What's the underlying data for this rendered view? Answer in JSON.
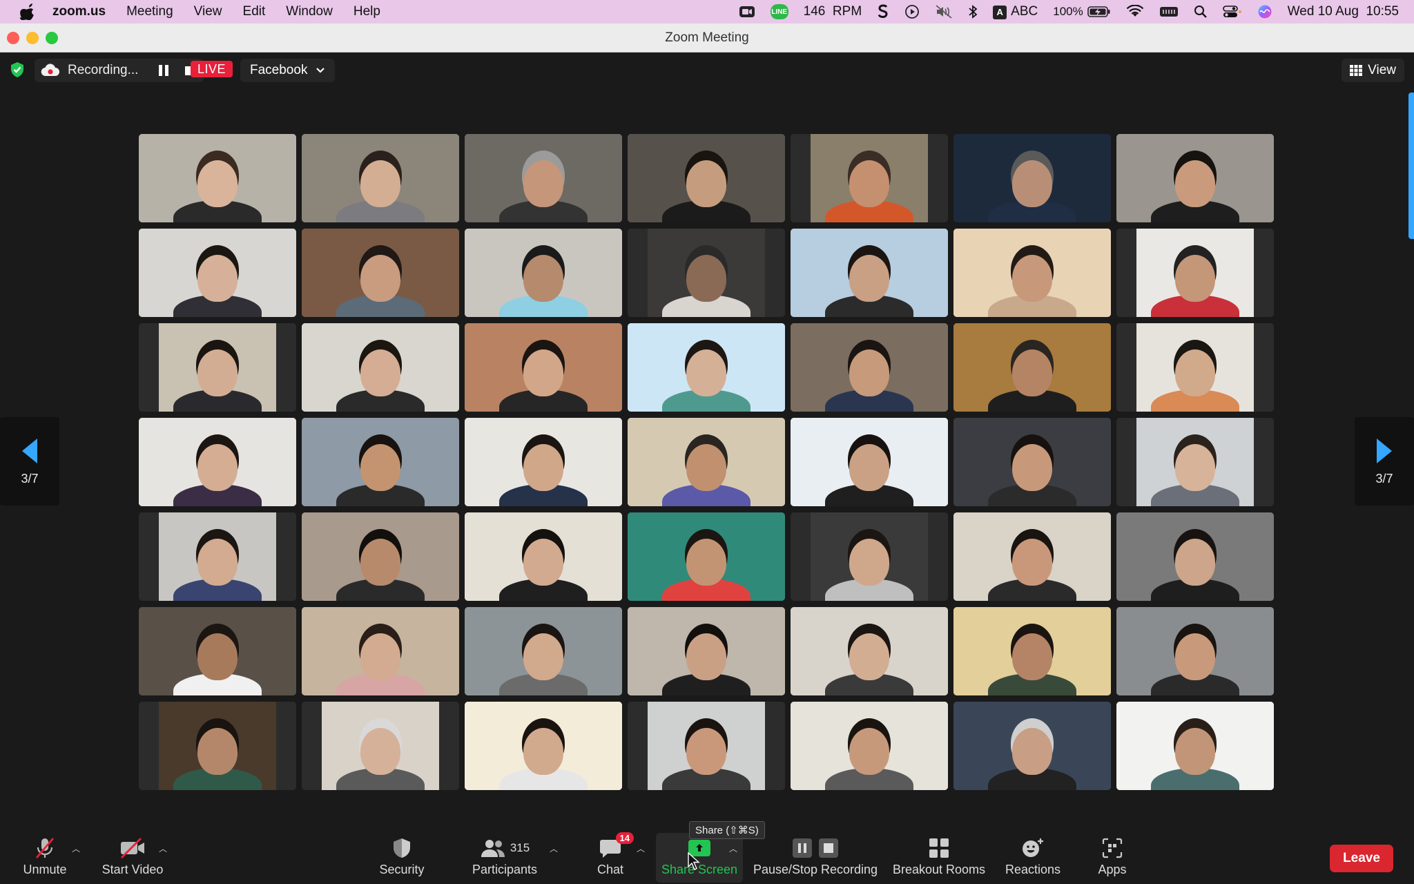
{
  "menubar": {
    "app_name": "zoom.us",
    "items": [
      "Meeting",
      "View",
      "Edit",
      "Window",
      "Help"
    ],
    "rpm_value": "146",
    "rpm_unit": "RPM",
    "input_source": "ABC",
    "input_letter": "A",
    "battery_percent": "100%",
    "datetime": "Wed 10 Aug  10:55",
    "line_label": "LINE"
  },
  "window": {
    "title": "Zoom Meeting"
  },
  "topstrip": {
    "recording_label": "Recording...",
    "live_label": "LIVE",
    "stream_target": "Facebook",
    "view_label": "View"
  },
  "gallery": {
    "page_indicator": "3/7",
    "tiles": [
      {
        "bg": "#b7b2a8",
        "skin": "#d9b49a",
        "shirt": "#2a2a2a",
        "hair": "#3a2a20",
        "narrow": false
      },
      {
        "bg": "#8c857a",
        "skin": "#d3ae92",
        "shirt": "#7b7b80",
        "hair": "#2b211c",
        "narrow": false
      },
      {
        "bg": "#6d6a63",
        "skin": "#c59679",
        "shirt": "#333",
        "hair": "#9b9b9b",
        "narrow": false
      },
      {
        "bg": "#56514b",
        "skin": "#c69c7e",
        "shirt": "#1b1b1b",
        "hair": "#1a1410",
        "narrow": false
      },
      {
        "bg": "#8a7f6b",
        "skin": "#c4906f",
        "shirt": "#d4572a",
        "hair": "#3a2d25",
        "narrow": true
      },
      {
        "bg": "#1d2a3c",
        "skin": "#b88f76",
        "shirt": "#1f2d45",
        "hair": "#5a5a5a",
        "narrow": false
      },
      {
        "bg": "#9a958e",
        "skin": "#c99b7c",
        "shirt": "#1e1e1e",
        "hair": "#151210",
        "narrow": false
      },
      {
        "bg": "#d8d6d2",
        "skin": "#d6b098",
        "shirt": "#2f2f35",
        "hair": "#1c1612",
        "narrow": false
      },
      {
        "bg": "#7a5a45",
        "skin": "#c99b7f",
        "shirt": "#5c6b78",
        "hair": "#201915",
        "narrow": false
      },
      {
        "bg": "#c9c6c0",
        "skin": "#b58a6d",
        "shirt": "#8ecfe3",
        "hair": "#1a1a1a",
        "narrow": false
      },
      {
        "bg": "#3b3a38",
        "skin": "#8a6a55",
        "shirt": "#d8d4cf",
        "hair": "#2a2a2a",
        "narrow": true
      },
      {
        "bg": "#b7cde0",
        "skin": "#c9a084",
        "shirt": "#2b2b2b",
        "hair": "#1a1512",
        "narrow": false
      },
      {
        "bg": "#e8d3b5",
        "skin": "#c7997a",
        "shirt": "#c8a98c",
        "hair": "#221a15",
        "narrow": false
      },
      {
        "bg": "#e9e8e4",
        "skin": "#c49779",
        "shirt": "#c9303a",
        "hair": "#222",
        "narrow": true
      },
      {
        "bg": "#c9c2b2",
        "skin": "#d3ad93",
        "shirt": "#2a2a2e",
        "hair": "#1b1511",
        "narrow": true
      },
      {
        "bg": "#d9d6d0",
        "skin": "#d5ad94",
        "shirt": "#2a2a2a",
        "hair": "#1c1611",
        "narrow": false
      },
      {
        "bg": "#b98363",
        "skin": "#d2a689",
        "shirt": "#262626",
        "hair": "#1b1511",
        "narrow": false
      },
      {
        "bg": "#cde6f5",
        "skin": "#d4b097",
        "shirt": "#4f9a8f",
        "hair": "#1d1714",
        "narrow": false
      },
      {
        "bg": "#7b6e60",
        "skin": "#c79a7b",
        "shirt": "#2a3650",
        "hair": "#1a1512",
        "narrow": false
      },
      {
        "bg": "#a87b3e",
        "skin": "#b58465",
        "shirt": "#1e1e1e",
        "hair": "#2a2520",
        "narrow": false
      },
      {
        "bg": "#e6e3dd",
        "skin": "#d1a98b",
        "shirt": "#d98a55",
        "hair": "#1a1612",
        "narrow": true
      },
      {
        "bg": "#e6e4e0",
        "skin": "#d4ad92",
        "shirt": "#3b2d45",
        "hair": "#1c1612",
        "narrow": false
      },
      {
        "bg": "#8e9aa6",
        "skin": "#c3946f",
        "shirt": "#2a2a2a",
        "hair": "#181310",
        "narrow": false
      },
      {
        "bg": "#e8e6e1",
        "skin": "#d1a78a",
        "shirt": "#26324a",
        "hair": "#1b1511",
        "narrow": false
      },
      {
        "bg": "#d6c9b2",
        "skin": "#c0906f",
        "shirt": "#5a5aa8",
        "hair": "#2a2520",
        "narrow": false
      },
      {
        "bg": "#e9eef3",
        "skin": "#caa184",
        "shirt": "#1f1f1f",
        "hair": "#17120f",
        "narrow": false
      },
      {
        "bg": "#3b3d42",
        "skin": "#c7997a",
        "shirt": "#2b2b2b",
        "hair": "#17120f",
        "narrow": false
      },
      {
        "bg": "#cfd2d4",
        "skin": "#d7b39a",
        "shirt": "#6a6f7a",
        "hair": "#2b221c",
        "narrow": true
      },
      {
        "bg": "#c8c6c3",
        "skin": "#d3ab90",
        "shirt": "#3a4470",
        "hair": "#1c1612",
        "narrow": true
      },
      {
        "bg": "#a89a8c",
        "skin": "#b88a6c",
        "shirt": "#2a2a2a",
        "hair": "#120f0d",
        "narrow": false
      },
      {
        "bg": "#e5e0d6",
        "skin": "#d2aa8f",
        "shirt": "#1f1f1f",
        "hair": "#15110e",
        "narrow": false
      },
      {
        "bg": "#2f8a7a",
        "skin": "#c39474",
        "shirt": "#e0433f",
        "hair": "#1c1612",
        "narrow": false
      },
      {
        "bg": "#3a3a3a",
        "skin": "#cfa88c",
        "shirt": "#bfbfbf",
        "hair": "#1c1612",
        "narrow": true
      },
      {
        "bg": "#d9d3c8",
        "skin": "#c9987b",
        "shirt": "#2a2a2a",
        "hair": "#1a1410",
        "narrow": false
      },
      {
        "bg": "#7a7a7a",
        "skin": "#cda58a",
        "shirt": "#1e1e1e",
        "hair": "#181310",
        "narrow": false
      },
      {
        "bg": "#595047",
        "skin": "#a87a5c",
        "shirt": "#f0f0f0",
        "hair": "#1c1612",
        "narrow": false
      },
      {
        "bg": "#c6b49f",
        "skin": "#d3ab90",
        "shirt": "#d8a5a5",
        "hair": "#2a1f18",
        "narrow": false
      },
      {
        "bg": "#8c9498",
        "skin": "#d1a98d",
        "shirt": "#6b6b6b",
        "hair": "#1a1512",
        "narrow": false
      },
      {
        "bg": "#bfb6ac",
        "skin": "#caa084",
        "shirt": "#1f1f1f",
        "hair": "#120f0d",
        "narrow": false
      },
      {
        "bg": "#d8d4cc",
        "skin": "#d3ad92",
        "shirt": "#3a3a3a",
        "hair": "#1b1511",
        "narrow": false
      },
      {
        "bg": "#e3cf9a",
        "skin": "#b58466",
        "shirt": "#3a4a3a",
        "hair": "#1a1410",
        "narrow": false
      },
      {
        "bg": "#8a8d90",
        "skin": "#c89a7b",
        "shirt": "#2a2a2a",
        "hair": "#1a1410",
        "narrow": false
      },
      {
        "bg": "#4a3a2c",
        "skin": "#b5876a",
        "shirt": "#2f5a4a",
        "hair": "#1a1410",
        "narrow": true
      },
      {
        "bg": "#d8d2c8",
        "skin": "#d6b19a",
        "shirt": "#5a5a5a",
        "hair": "#d9d9d9",
        "narrow": true
      },
      {
        "bg": "#f3ecd8",
        "skin": "#d1a98d",
        "shirt": "#e6e6e6",
        "hair": "#1a1410",
        "narrow": false
      },
      {
        "bg": "#cfd0d0",
        "skin": "#c9987b",
        "shirt": "#3a3a3a",
        "hair": "#1a1410",
        "narrow": true
      },
      {
        "bg": "#e6e3da",
        "skin": "#c7997b",
        "shirt": "#5a5a5a",
        "hair": "#1a1410",
        "narrow": false
      },
      {
        "bg": "#3a4658",
        "skin": "#c89e84",
        "shirt": "#222",
        "hair": "#cfcfcf",
        "narrow": false
      },
      {
        "bg": "#f2f2f0",
        "skin": "#c39578",
        "shirt": "#4a6e6e",
        "hair": "#2a1f18",
        "narrow": false
      }
    ]
  },
  "toolbar": {
    "unmute": "Unmute",
    "start_video": "Start Video",
    "security": "Security",
    "participants": "Participants",
    "participant_count": "315",
    "chat": "Chat",
    "chat_badge": "14",
    "share_screen": "Share Screen",
    "share_tooltip": "Share (⇧⌘S)",
    "pause_stop_recording": "Pause/Stop Recording",
    "breakout_rooms": "Breakout Rooms",
    "reactions": "Reactions",
    "apps": "Apps",
    "leave": "Leave"
  },
  "colors": {
    "menubar_bg": "#e8c7e9",
    "accent_blue": "#35a7ff",
    "share_green": "#23c552",
    "live_red": "#e8203a",
    "leave_red": "#d9262f"
  }
}
